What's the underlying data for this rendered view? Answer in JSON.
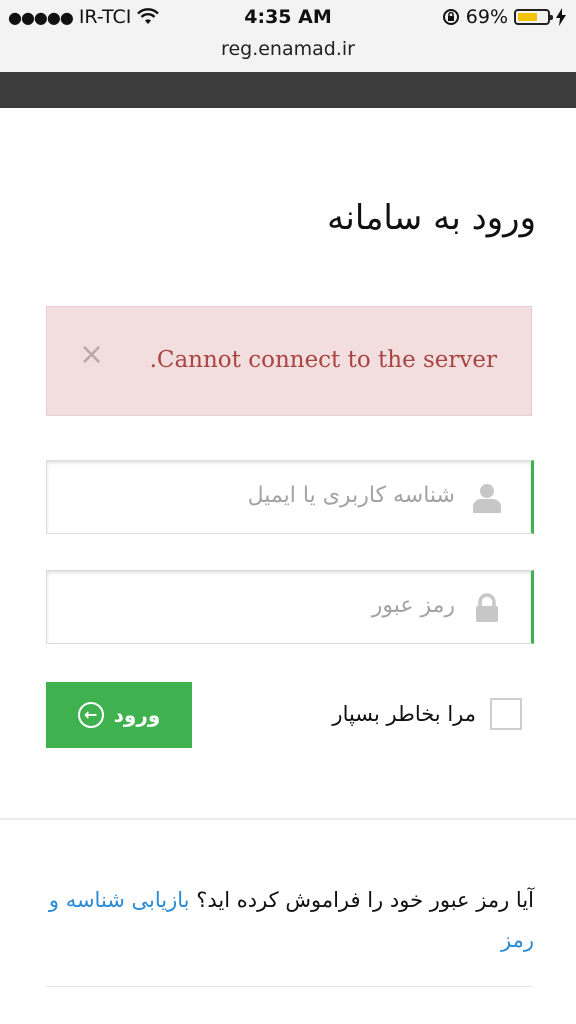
{
  "status_bar": {
    "carrier": "IR-TCI",
    "time": "4:35 AM",
    "battery": "69%",
    "battery_level": 0.69
  },
  "browser": {
    "url": "reg.enamad.ir"
  },
  "page": {
    "title": "ورود به سامانه"
  },
  "alert": {
    "message": ".Cannot connect to the server",
    "close_label": "×"
  },
  "form": {
    "username_placeholder": "شناسه کاربری یا ایمیل",
    "password_placeholder": "رمز عبور",
    "remember_label": "مرا بخاطر بسپار",
    "login_label": "ورود"
  },
  "forgot": {
    "text": "آیا رمز عبور خود را فراموش کرده اید؟",
    "link": "بازیابی شناسه و رمز"
  },
  "colors": {
    "accent": "#3fb14f",
    "alert_bg": "#f2dede",
    "alert_text": "#a94442",
    "link": "#2a8bd6"
  }
}
